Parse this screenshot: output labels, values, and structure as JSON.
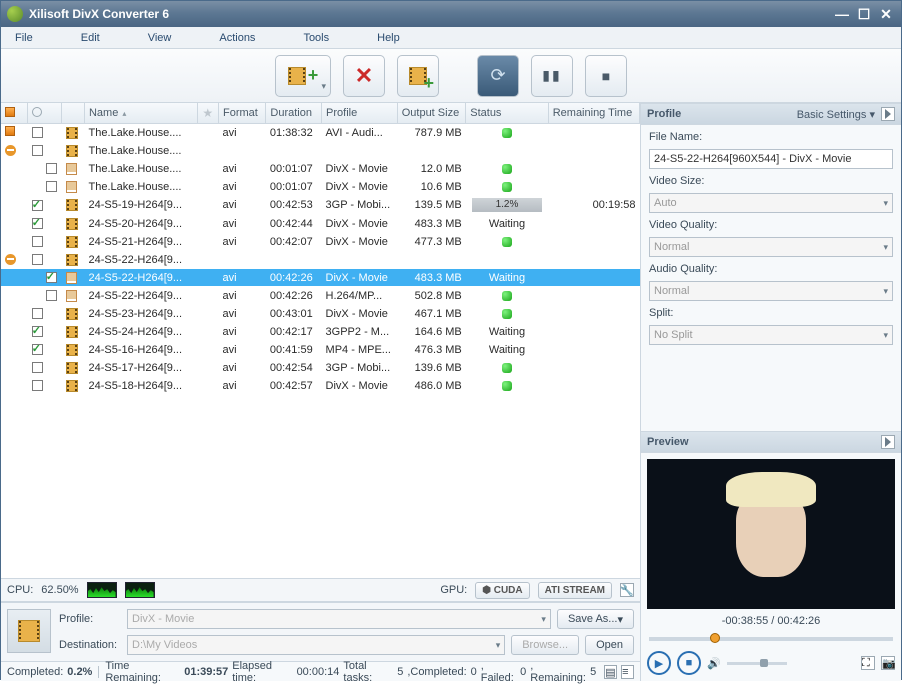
{
  "window": {
    "title": "Xilisoft DivX Converter 6"
  },
  "menu": [
    "File",
    "Edit",
    "View",
    "Actions",
    "Tools",
    "Help"
  ],
  "columns": [
    "",
    "",
    "",
    "Name",
    "",
    "Format",
    "Duration",
    "Profile",
    "Output Size",
    "Status",
    "Remaining Time"
  ],
  "rows": [
    {
      "tree": "sq",
      "chk": false,
      "ico": "film",
      "name": "The.Lake.House....",
      "fmt": "avi",
      "dur": "01:38:32",
      "prof": "AVI - Audi...",
      "size": "787.9 MB",
      "status": "dot",
      "rem": "",
      "sel": false,
      "indent": 0
    },
    {
      "tree": "minus",
      "chk": false,
      "ico": "film",
      "name": "The.Lake.House....",
      "fmt": "",
      "dur": "",
      "prof": "",
      "size": "",
      "status": "",
      "rem": "",
      "sel": false,
      "indent": 0
    },
    {
      "tree": "",
      "chk": false,
      "ico": "doc",
      "name": "The.Lake.House....",
      "fmt": "avi",
      "dur": "00:01:07",
      "prof": "DivX - Movie",
      "size": "12.0 MB",
      "status": "dot",
      "rem": "",
      "sel": false,
      "indent": 1
    },
    {
      "tree": "",
      "chk": false,
      "ico": "doc",
      "name": "The.Lake.House....",
      "fmt": "avi",
      "dur": "00:01:07",
      "prof": "DivX - Movie",
      "size": "10.6 MB",
      "status": "dot",
      "rem": "",
      "sel": false,
      "indent": 1
    },
    {
      "tree": "",
      "chk": true,
      "ico": "film",
      "name": "24-S5-19-H264[9...",
      "fmt": "avi",
      "dur": "00:42:53",
      "prof": "3GP - Mobi...",
      "size": "139.5 MB",
      "status": "progress",
      "statusText": "1.2%",
      "rem": "00:19:58",
      "sel": false,
      "indent": 0
    },
    {
      "tree": "",
      "chk": true,
      "ico": "film",
      "name": "24-S5-20-H264[9...",
      "fmt": "avi",
      "dur": "00:42:44",
      "prof": "DivX - Movie",
      "size": "483.3 MB",
      "status": "text",
      "statusText": "Waiting",
      "rem": "",
      "sel": false,
      "indent": 0
    },
    {
      "tree": "",
      "chk": false,
      "ico": "film",
      "name": "24-S5-21-H264[9...",
      "fmt": "avi",
      "dur": "00:42:07",
      "prof": "DivX - Movie",
      "size": "477.3 MB",
      "status": "dot",
      "rem": "",
      "sel": false,
      "indent": 0
    },
    {
      "tree": "minus",
      "chk": false,
      "ico": "film",
      "name": "24-S5-22-H264[9...",
      "fmt": "",
      "dur": "",
      "prof": "",
      "size": "",
      "status": "",
      "rem": "",
      "sel": false,
      "indent": 0
    },
    {
      "tree": "",
      "chk": true,
      "ico": "doc",
      "name": "24-S5-22-H264[9...",
      "fmt": "avi",
      "dur": "00:42:26",
      "prof": "DivX - Movie",
      "size": "483.3 MB",
      "status": "text",
      "statusText": "Waiting",
      "rem": "",
      "sel": true,
      "indent": 1
    },
    {
      "tree": "",
      "chk": false,
      "ico": "doc",
      "name": "24-S5-22-H264[9...",
      "fmt": "avi",
      "dur": "00:42:26",
      "prof": "H.264/MP...",
      "size": "502.8 MB",
      "status": "dot",
      "rem": "",
      "sel": false,
      "indent": 1
    },
    {
      "tree": "",
      "chk": false,
      "ico": "film",
      "name": "24-S5-23-H264[9...",
      "fmt": "avi",
      "dur": "00:43:01",
      "prof": "DivX - Movie",
      "size": "467.1 MB",
      "status": "dot",
      "rem": "",
      "sel": false,
      "indent": 0
    },
    {
      "tree": "",
      "chk": true,
      "ico": "film",
      "name": "24-S5-24-H264[9...",
      "fmt": "avi",
      "dur": "00:42:17",
      "prof": "3GPP2 - M...",
      "size": "164.6 MB",
      "status": "text",
      "statusText": "Waiting",
      "rem": "",
      "sel": false,
      "indent": 0
    },
    {
      "tree": "",
      "chk": true,
      "ico": "film",
      "name": "24-S5-16-H264[9...",
      "fmt": "avi",
      "dur": "00:41:59",
      "prof": "MP4 - MPE...",
      "size": "476.3 MB",
      "status": "text",
      "statusText": "Waiting",
      "rem": "",
      "sel": false,
      "indent": 0
    },
    {
      "tree": "",
      "chk": false,
      "ico": "film",
      "name": "24-S5-17-H264[9...",
      "fmt": "avi",
      "dur": "00:42:54",
      "prof": "3GP - Mobi...",
      "size": "139.6 MB",
      "status": "dot",
      "rem": "",
      "sel": false,
      "indent": 0
    },
    {
      "tree": "",
      "chk": false,
      "ico": "film",
      "name": "24-S5-18-H264[9...",
      "fmt": "avi",
      "dur": "00:42:57",
      "prof": "DivX - Movie",
      "size": "486.0 MB",
      "status": "dot",
      "rem": "",
      "sel": false,
      "indent": 0
    }
  ],
  "cpu": {
    "label": "CPU:",
    "value": "62.50%"
  },
  "gpu": {
    "label": "GPU:",
    "cuda": "CUDA",
    "ati": "ATI STREAM"
  },
  "bottom": {
    "profileLabel": "Profile:",
    "profileValue": "DivX - Movie",
    "destLabel": "Destination:",
    "destValue": "D:\\My Videos",
    "saveAs": "Save As...",
    "browse": "Browse...",
    "open": "Open"
  },
  "status": {
    "completedLabel": "Completed: ",
    "completedVal": "0.2%",
    "remLabel": "Time Remaining: ",
    "remVal": "01:39:57",
    "elapsedLabel": "Elapsed time: ",
    "elapsedVal": "00:00:14",
    "totalLabel": "Total tasks: ",
    "totalVal": "5",
    "compLabel": ",Completed: ",
    "compVal": "0",
    "failLabel": ", Failed: ",
    "failVal": "0",
    "remainLabel": ", Remaining: ",
    "remainVal": "5"
  },
  "profilePanel": {
    "header": "Profile",
    "basic": "Basic Settings",
    "fileNameLabel": "File Name:",
    "fileName": "24-S5-22-H264[960X544] - DivX - Movie",
    "videoSizeLabel": "Video Size:",
    "videoSize": "Auto",
    "videoQualLabel": "Video Quality:",
    "videoQual": "Normal",
    "audioQualLabel": "Audio Quality:",
    "audioQual": "Normal",
    "splitLabel": "Split:",
    "split": "No Split"
  },
  "preview": {
    "header": "Preview",
    "time": "-00:38:55 / 00:42:26"
  }
}
